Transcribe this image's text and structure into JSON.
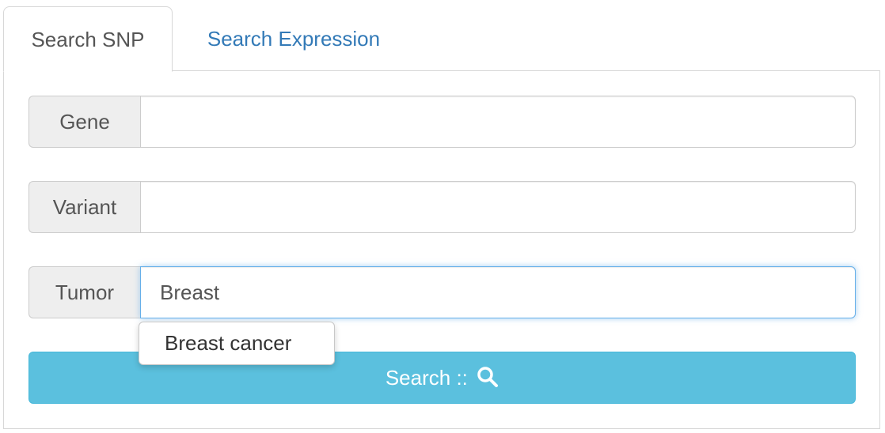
{
  "tabs": [
    {
      "label": "Search SNP",
      "active": true
    },
    {
      "label": "Search Expression",
      "active": false
    }
  ],
  "form": {
    "gene": {
      "label": "Gene",
      "value": ""
    },
    "variant": {
      "label": "Variant",
      "value": ""
    },
    "tumor": {
      "label": "Tumor",
      "value": "Breast"
    }
  },
  "autocomplete": {
    "suggestions": [
      "Breast cancer"
    ]
  },
  "search_button": {
    "label": "Search ::",
    "icon": "search-icon"
  },
  "colors": {
    "link": "#337ab7",
    "button": "#5bc0de",
    "focus_border": "#66afe9"
  }
}
